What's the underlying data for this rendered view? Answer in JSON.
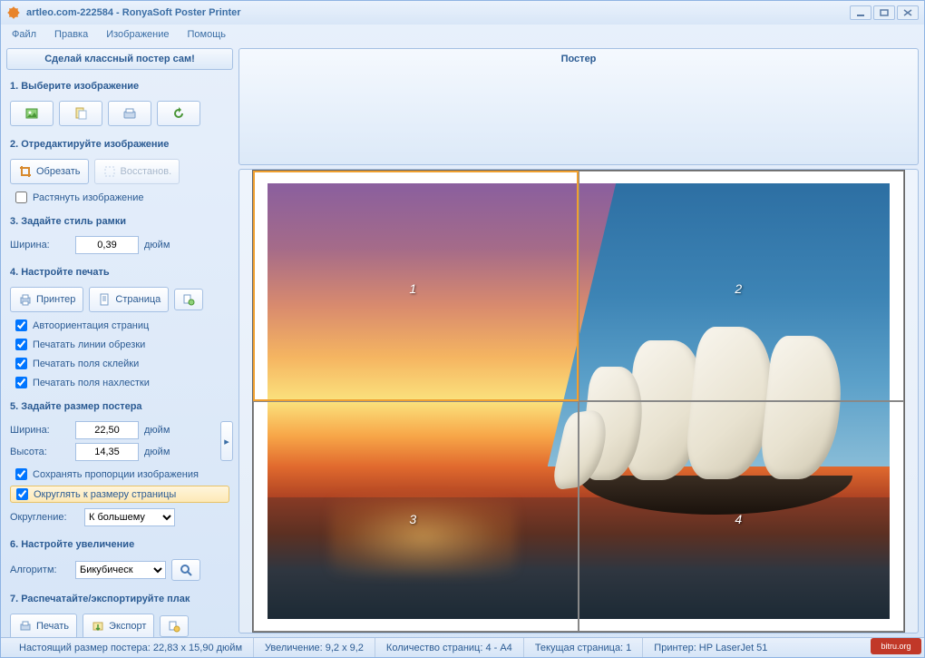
{
  "title": "artleo.com-222584 - RonyaSoft Poster Printer",
  "menu": {
    "file": "Файл",
    "edit": "Правка",
    "image": "Изображение",
    "help": "Помощь"
  },
  "topButton": "Сделай классный постер сам!",
  "posterHeader": "Постер",
  "sidebar": {
    "step1": {
      "title": "1. Выберите изображение"
    },
    "step2": {
      "title": "2. Отредактируйте изображение",
      "crop": "Обрезать",
      "restore": "Восстанов.",
      "stretch": "Растянуть изображение"
    },
    "step3": {
      "title": "3. Задайте стиль рамки",
      "widthLabel": "Ширина:",
      "widthValue": "0,39",
      "unit": "дюйм"
    },
    "step4": {
      "title": "4. Настройте печать",
      "printer": "Принтер",
      "page": "Страница",
      "autoOrient": "Автоориентация страниц",
      "cropLines": "Печатать линии обрезки",
      "glueFields": "Печатать поля склейки",
      "overlapFields": "Печатать поля нахлестки"
    },
    "step5": {
      "title": "5. Задайте размер постера",
      "widthLabel": "Ширина:",
      "widthValue": "22,50",
      "heightLabel": "Высота:",
      "heightValue": "14,35",
      "unit": "дюйм",
      "keepProp": "Сохранять пропорции изображения",
      "roundToPage": "Округлять к размеру страницы",
      "roundingLabel": "Округление:",
      "roundingValue": "К большему"
    },
    "step6": {
      "title": "6. Настройте увеличение",
      "algoLabel": "Алгоритм:",
      "algoValue": "Бикубическ"
    },
    "step7": {
      "title": "7. Распечатайте/экспортируйте плак",
      "print": "Печать",
      "export": "Экспорт"
    }
  },
  "pages": [
    "1",
    "2",
    "3",
    "4"
  ],
  "status": {
    "realSize": "Настоящий размер постера: 22,83 x 15,90 дюйм",
    "zoom": "Увеличение: 9,2 x 9,2",
    "pageCount": "Количество страниц: 4 - A4",
    "currentPage": "Текущая страница: 1",
    "printer": "Принтер: HP LaserJet 51"
  },
  "watermark": "bitru.org"
}
